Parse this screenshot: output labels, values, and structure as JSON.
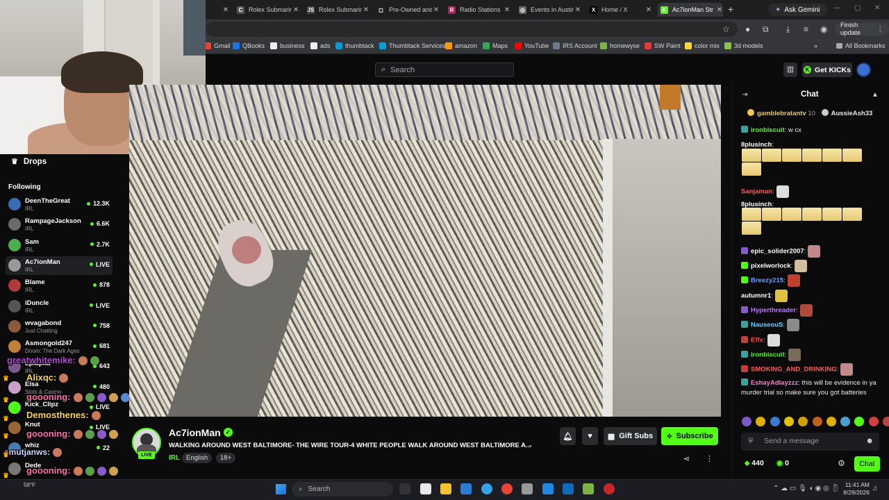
{
  "browser": {
    "tabs": [
      {
        "title": "",
        "fav_color": "#4a4a4a",
        "fav_glyph": ""
      },
      {
        "title": "Rolex Submarin",
        "fav_color": "#555",
        "fav_glyph": "C"
      },
      {
        "title": "Rolex Submarin",
        "fav_color": "#444",
        "fav_glyph": "JS"
      },
      {
        "title": "Pre-Owned and",
        "fav_color": "#222",
        "fav_glyph": "◻"
      },
      {
        "title": "Radio Stations",
        "fav_color": "#c2185b",
        "fav_glyph": "R"
      },
      {
        "title": "Events in Austin",
        "fav_color": "#666",
        "fav_glyph": "◎"
      },
      {
        "title": "Home / X",
        "fav_color": "#000",
        "fav_glyph": "X"
      },
      {
        "title": "Ac7ionMan Str",
        "fav_color": "#53fc18",
        "fav_glyph": "K"
      }
    ],
    "ask_gemini": "Ask Gemini",
    "finish_update": "Finish update",
    "bookmarks": [
      {
        "label": "Gmail",
        "color": "#ea4335"
      },
      {
        "label": "QBooks",
        "color": "#1a73e8"
      },
      {
        "label": "business",
        "color": "#eee"
      },
      {
        "label": "ads",
        "color": "#eee"
      },
      {
        "label": "thumbtack",
        "color": "#009fd9"
      },
      {
        "label": "Thumbtack Services",
        "color": "#009fd9"
      },
      {
        "label": "amazon",
        "color": "#ff9900"
      },
      {
        "label": "Maps",
        "color": "#34a853"
      },
      {
        "label": "YouTube",
        "color": "#ff0000"
      },
      {
        "label": "IRS Account",
        "color": "#6c7a89"
      },
      {
        "label": "homewyse",
        "color": "#7cb342"
      },
      {
        "label": "SW Paint",
        "color": "#e53935"
      },
      {
        "label": "color mix",
        "color": "#fdd835"
      },
      {
        "label": "3d models",
        "color": "#8bc34a"
      }
    ],
    "all_bookmarks": "All Bookmarks"
  },
  "header": {
    "search_placeholder": "Search",
    "get_kicks": "Get KICKs"
  },
  "sidebar": {
    "drops": "Drops",
    "following": "Following",
    "channels": [
      {
        "name": "DeenTheGreat",
        "category": "IRL",
        "viewers": "12.3K",
        "color": "#3b6bb0"
      },
      {
        "name": "RampageJackson",
        "category": "IRL",
        "viewers": "6.6K",
        "color": "#6b6b6b"
      },
      {
        "name": "Sam",
        "category": "IRL",
        "viewers": "2.7K",
        "color": "#4caf50"
      },
      {
        "name": "Ac7ionMan",
        "category": "IRL",
        "viewers": "LIVE",
        "color": "#999"
      },
      {
        "name": "Blame",
        "category": "IRL",
        "viewers": "878",
        "color": "#b03a3a"
      },
      {
        "name": "iDuncle",
        "category": "IRL",
        "viewers": "LIVE",
        "color": "#555"
      },
      {
        "name": "wvagabond",
        "category": "Just Chatting",
        "viewers": "758",
        "color": "#8a5a3a"
      },
      {
        "name": "Asmongold247",
        "category": "Doom: The Dark Ages",
        "viewers": "681",
        "color": "#c0803a"
      },
      {
        "name": "Lplupka",
        "category": "IRL",
        "viewers": "643",
        "color": "#7a5a8a"
      },
      {
        "name": "Elsa",
        "category": "Slots & Casino",
        "viewers": "480",
        "color": "#c9a0c9"
      },
      {
        "name": "Kick_Clipz",
        "category": "",
        "viewers": "LIVE",
        "color": "#53fc18"
      },
      {
        "name": "Knut",
        "category": "",
        "viewers": "LIVE",
        "color": "#996633"
      },
      {
        "name": "whiz",
        "category": "",
        "viewers": "22",
        "color": "#4a7ab0"
      },
      {
        "name": "Dede",
        "category": "",
        "viewers": "",
        "color": "#777"
      }
    ],
    "overlay": [
      {
        "text": "greatwhitemike:",
        "color": "#b04ad0"
      },
      {
        "text": "Alixqc:",
        "color": "#ffd54a"
      },
      {
        "text": "goooning:",
        "color": "#ff6fae"
      },
      {
        "text": "Demosthenes:",
        "color": "#ffd54a"
      },
      {
        "text": "goooning:",
        "color": "#ff6fae"
      },
      {
        "text": "smutjanws:",
        "color": "#cfd8ff"
      },
      {
        "text": "goooning:",
        "color": "#ff6fae"
      }
    ]
  },
  "stream": {
    "channel": "Ac7ionMan",
    "live_label": "LIVE",
    "title": "WALKING AROUND WEST BALTIMORE- THE WIRE TOUR-4 WHITE PEOPLE WALK AROUND WEST BALTIMORE A...",
    "category": "IRL",
    "tags": [
      "English",
      "18+"
    ],
    "gift_subs": "Gift Subs",
    "subscribe": "Subscribe"
  },
  "chat": {
    "title": "Chat",
    "pinned": [
      {
        "user": "gamblebratantv",
        "amount": "10",
        "color": "#f2c94c"
      },
      {
        "user": "AussieAsh33",
        "amount": "",
        "color": "#ffffff"
      }
    ],
    "messages": [
      {
        "user": "ironbiscuit",
        "text": " w cx",
        "color": "#53fc18"
      },
      {
        "user": "8plusinch",
        "text": "",
        "color": "#ffffff"
      },
      {
        "user": "Sanjaman",
        "text": "",
        "color": "#ff5a5a"
      },
      {
        "user": "8plusinch",
        "text": "",
        "color": "#ffffff"
      },
      {
        "user": "epic_solider2007",
        "text": "",
        "color": "#ffffff"
      },
      {
        "user": "pixelworlock",
        "text": "",
        "color": "#ffffff"
      },
      {
        "user": "Breezy215",
        "text": "",
        "color": "#6aa0ff"
      },
      {
        "user": "autumnr1",
        "text": "",
        "color": "#ffffff"
      },
      {
        "user": "Hyperthreader",
        "text": "",
        "color": "#c07aff"
      },
      {
        "user": "NauseouS",
        "text": "",
        "color": "#6ad0ff"
      },
      {
        "user": "Effx",
        "text": "",
        "color": "#ff4444"
      },
      {
        "user": "ironbiscuit",
        "text": "",
        "color": "#53fc18"
      },
      {
        "user": "SMOKING_AND_DRINKING",
        "text": "",
        "color": "#ff5a5a"
      },
      {
        "user": "EshayAdlayzzz",
        "text": " this will be evidence in ya murder trial so make sure you got batteries",
        "color": "#ff7ad0"
      }
    ],
    "send_placeholder": "Send a message",
    "points": "440",
    "kicks": "0",
    "chat_button": "Chat"
  },
  "taskbar": {
    "weather": "58°F",
    "search": "Search",
    "time": "11:41 AM",
    "date": "8/29/2026"
  },
  "colors": {
    "kick_green": "#53fc18",
    "background": "#0b0b0c"
  }
}
